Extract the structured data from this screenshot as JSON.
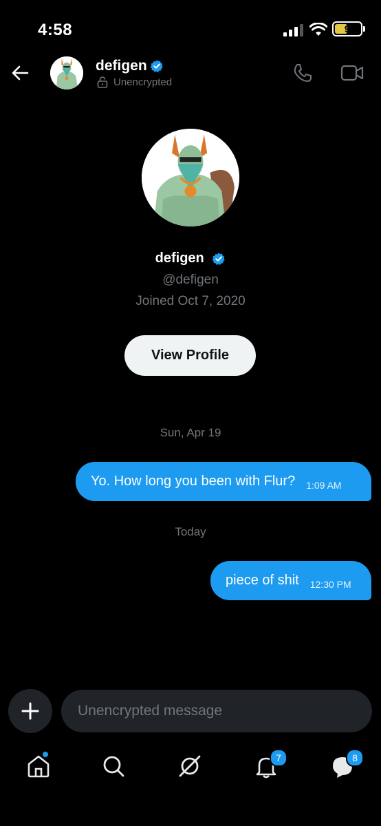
{
  "status_bar": {
    "time": "4:58",
    "battery": "9"
  },
  "header": {
    "name": "defigen",
    "subtitle": "Unencrypted"
  },
  "profile": {
    "name": "defigen",
    "handle": "@defigen",
    "joined": "Joined Oct 7, 2020",
    "view_profile_label": "View Profile"
  },
  "messages": [
    {
      "date": "Sun, Apr 19",
      "text": "Yo. How long you been with Flur?",
      "time": "1:09 AM"
    },
    {
      "date": "Today",
      "text": "piece of shit",
      "time": "12:30 PM"
    }
  ],
  "composer": {
    "placeholder": "Unencrypted message"
  },
  "tabbar": {
    "notifications_count": "7",
    "messages_count": "8"
  },
  "icons": [
    "back-arrow-icon",
    "verified-badge-icon",
    "lock-icon",
    "phone-icon",
    "video-icon",
    "plus-icon",
    "home-icon",
    "search-icon",
    "grok-icon",
    "bell-icon",
    "messages-icon"
  ],
  "colors": {
    "accent": "#1d9bf0",
    "background": "#000000",
    "button_light": "#eff3f4",
    "muted": "#71767b"
  }
}
